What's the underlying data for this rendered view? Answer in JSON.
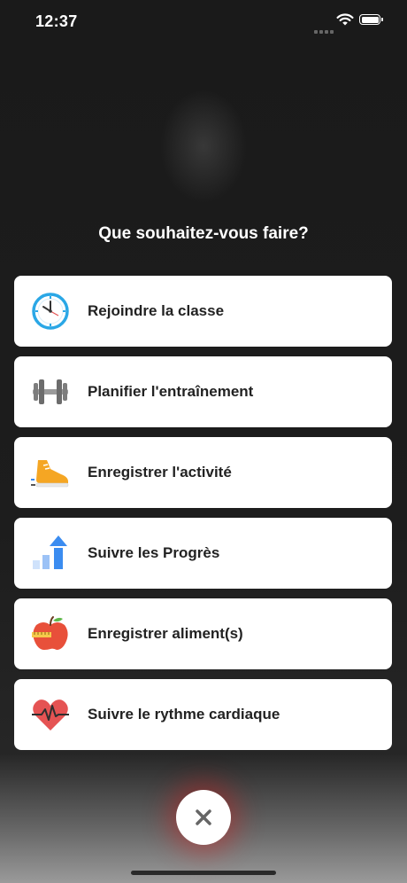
{
  "status_bar": {
    "time": "12:37"
  },
  "prompt": "Que souhaitez-vous faire?",
  "actions": [
    {
      "label": "Rejoindre la classe",
      "icon": "clock-icon"
    },
    {
      "label": "Planifier l'entraînement",
      "icon": "dumbbell-icon"
    },
    {
      "label": "Enregistrer l'activité",
      "icon": "sneaker-icon"
    },
    {
      "label": "Suivre les Progrès",
      "icon": "progress-chart-icon"
    },
    {
      "label": "Enregistrer aliment(s)",
      "icon": "apple-icon"
    },
    {
      "label": "Suivre le rythme cardiaque",
      "icon": "heart-rate-icon"
    }
  ],
  "colors": {
    "background": "#1b1b1b",
    "card": "#ffffff",
    "clock_blue": "#2aa7e6",
    "progress_blue": "#3b8cf0",
    "sneaker_orange": "#f5a623",
    "apple_red": "#e8503a",
    "heart_red": "#e55353",
    "close_glow": "#c81e1e"
  }
}
